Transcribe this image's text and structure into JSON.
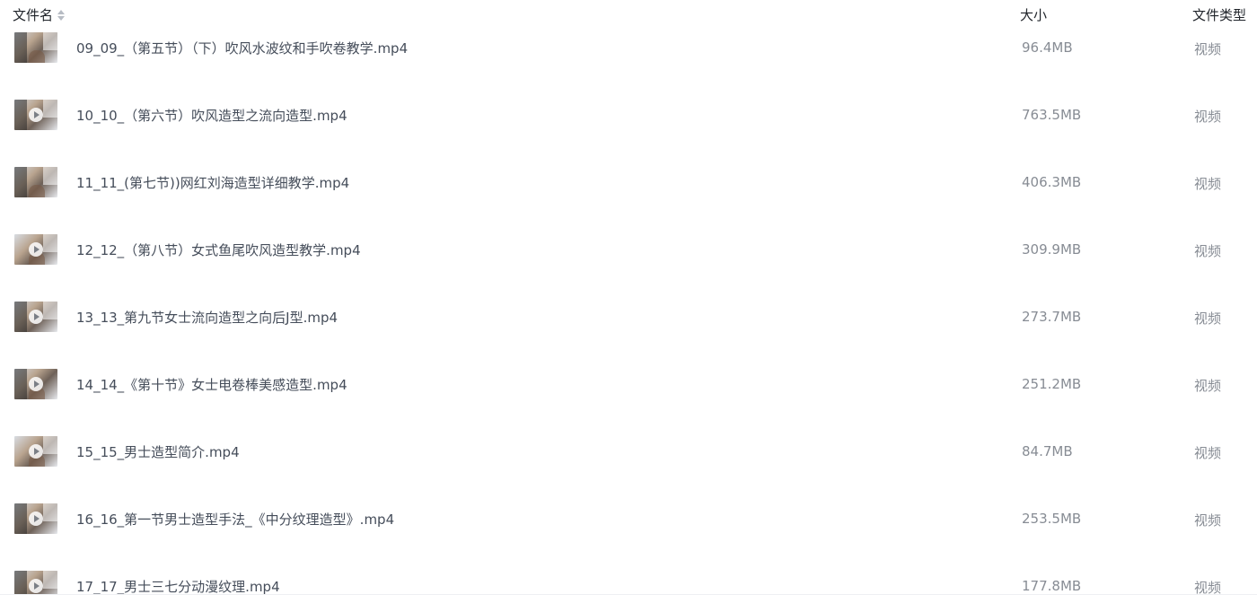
{
  "columns": {
    "name": "文件名",
    "size": "大小",
    "type": "文件类型"
  },
  "sort_icon": "sort-icon",
  "files": [
    {
      "name": "09_09_（第五节）（下）吹风水波纹和手吹卷教学.mp4",
      "size": "96.4MB",
      "type": "视频"
    },
    {
      "name": "10_10_（第六节）吹风造型之流向造型.mp4",
      "size": "763.5MB",
      "type": "视频"
    },
    {
      "name": "11_11_(第七节))网红刘海造型详细教学.mp4",
      "size": "406.3MB",
      "type": "视频"
    },
    {
      "name": "12_12_（第八节）女式鱼尾吹风造型教学.mp4",
      "size": "309.9MB",
      "type": "视频"
    },
    {
      "name": "13_13_第九节女士流向造型之向后J型.mp4",
      "size": "273.7MB",
      "type": "视频"
    },
    {
      "name": "14_14_《第十节》女士电卷棒美感造型.mp4",
      "size": "251.2MB",
      "type": "视频"
    },
    {
      "name": "15_15_男士造型简介.mp4",
      "size": "84.7MB",
      "type": "视频"
    },
    {
      "name": "16_16_第一节男士造型手法_《中分纹理造型》.mp4",
      "size": "253.5MB",
      "type": "视频"
    },
    {
      "name": "17_17_男士三七分动漫纹理.mp4",
      "size": "177.8MB",
      "type": "视频"
    }
  ]
}
